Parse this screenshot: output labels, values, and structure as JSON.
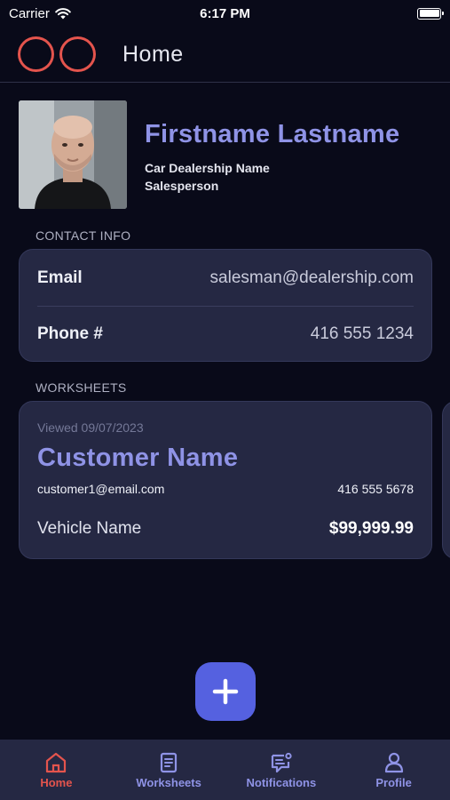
{
  "status_bar": {
    "carrier": "Carrier",
    "time": "6:17 PM"
  },
  "header": {
    "title": "Home"
  },
  "profile": {
    "name": "Firstname Lastname",
    "dealership": "Car Dealership Name",
    "role": "Salesperson"
  },
  "contact": {
    "section_label": "CONTACT INFO",
    "email_label": "Email",
    "email_value": "salesman@dealership.com",
    "phone_label": "Phone #",
    "phone_value": "416 555 1234"
  },
  "worksheets": {
    "section_label": "WORKSHEETS",
    "items": [
      {
        "viewed": "Viewed 09/07/2023",
        "customer_name": "Customer Name",
        "email": "customer1@email.com",
        "phone": "416 555 5678",
        "vehicle": "Vehicle Name",
        "price": "$99,999.99"
      }
    ]
  },
  "tab_bar": {
    "items": [
      {
        "label": "Home",
        "icon": "home-icon",
        "active": true
      },
      {
        "label": "Worksheets",
        "icon": "worksheet-icon",
        "active": false
      },
      {
        "label": "Notifications",
        "icon": "notifications-icon",
        "active": false
      },
      {
        "label": "Profile",
        "icon": "profile-icon",
        "active": false
      }
    ]
  },
  "colors": {
    "background": "#090a19",
    "card": "#252843",
    "accent_text": "#8f93e6",
    "logo": "#e4544d",
    "fab": "#5561e0",
    "tab_active": "#e4544d",
    "tab_inactive": "#8f93e6"
  }
}
